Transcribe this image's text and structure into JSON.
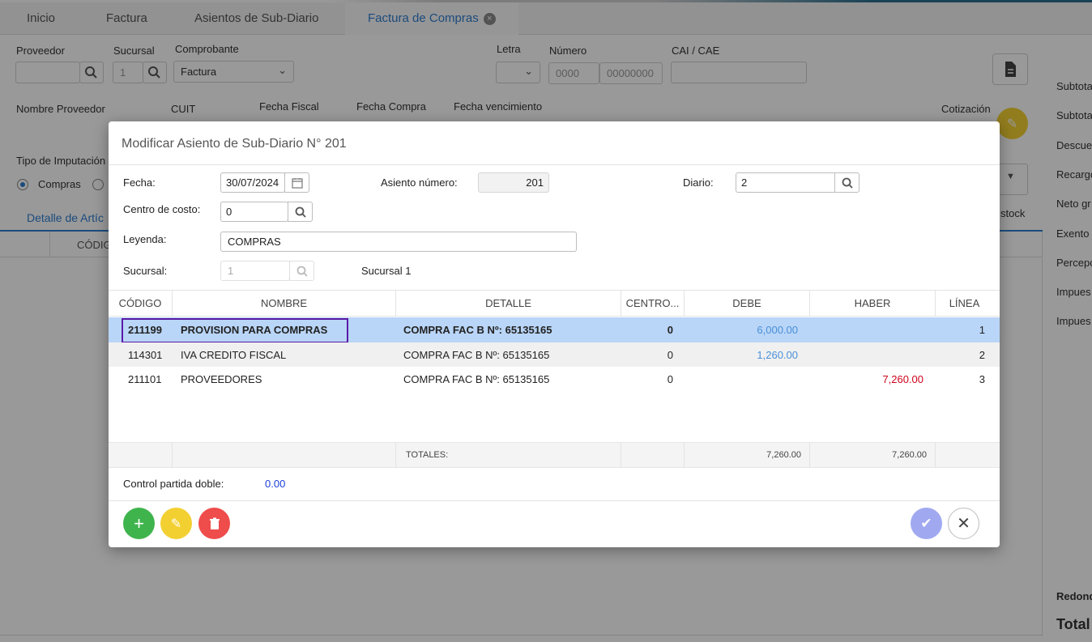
{
  "tabs": [
    {
      "label": "Inicio"
    },
    {
      "label": "Factura"
    },
    {
      "label": "Asientos de Sub-Diario"
    },
    {
      "label": "Factura de Compras"
    }
  ],
  "form": {
    "proveedor_label": "Proveedor",
    "sucursal_label": "Sucursal",
    "sucursal_value": "1",
    "comprobante_label": "Comprobante",
    "comprobante_value": "Factura",
    "letra_label": "Letra",
    "numero_label": "Número",
    "numero_pv_placeholder": "0000",
    "numero_nro_placeholder": "00000000",
    "cai_label": "CAI / CAE",
    "nombre_proveedor_label": "Nombre Proveedor",
    "cuit_label": "CUIT",
    "fecha_fiscal_label": "Fecha Fiscal",
    "fecha_compra_label": "Fecha Compra",
    "fecha_vencimiento_label": "Fecha vencimiento",
    "cotizacion_label": "Cotización",
    "tipo_imputacion_label": "Tipo de Imputación C",
    "radio_compras_label": "Compras",
    "detalle_tab_label": "Detalle de Artíc",
    "codigo_col_label": "CÓDIG",
    "stock_label": "stock"
  },
  "right_panel": {
    "labels": [
      "Subtota",
      "Subtota",
      "Descue",
      "Recargo",
      "Neto gr",
      "Exento",
      "Percepc",
      "Impues",
      "Impues"
    ],
    "redondeo_label": "Redonde",
    "total_label": "Total"
  },
  "modal": {
    "title": "Modificar Asiento de Sub-Diario N° 201",
    "fecha_label": "Fecha:",
    "fecha_value": "30/07/2024",
    "asiento_label": "Asiento número:",
    "asiento_value": "201",
    "diario_label": "Diario:",
    "diario_value": "2",
    "centro_label": "Centro de costo:",
    "centro_value": "0",
    "leyenda_label": "Leyenda:",
    "leyenda_value": "COMPRAS",
    "sucursal_label": "Sucursal:",
    "sucursal_value": "1",
    "sucursal_name": "Sucursal 1",
    "columns": [
      "CÓDIGO",
      "NOMBRE",
      "DETALLE",
      "CENTRO...",
      "DEBE",
      "HABER",
      "LÍNEA"
    ],
    "rows": [
      {
        "codigo": "211199",
        "nombre": "PROVISION PARA COMPRAS",
        "detalle": "COMPRA FAC B Nº: 65135165",
        "centro": "0",
        "debe": "6,000.00",
        "haber": "",
        "linea": "1"
      },
      {
        "codigo": "114301",
        "nombre": "IVA CREDITO FISCAL",
        "detalle": "COMPRA FAC B Nº: 65135165",
        "centro": "0",
        "debe": "1,260.00",
        "haber": "",
        "linea": "2"
      },
      {
        "codigo": "211101",
        "nombre": "PROVEEDORES",
        "detalle": "COMPRA FAC B Nº: 65135165",
        "centro": "0",
        "debe": "",
        "haber": "7,260.00",
        "linea": "3"
      }
    ],
    "totales_label": "TOTALES:",
    "total_debe": "7,260.00",
    "total_haber": "7,260.00",
    "control_label": "Control partida doble:",
    "control_value": "0.00",
    "colors": {
      "debe": "#4a90d9",
      "haber": "#d0021b",
      "control": "#1a3fd6",
      "selected_row": "#b9d5f7",
      "highlight_border": "#5b1aa8"
    }
  }
}
